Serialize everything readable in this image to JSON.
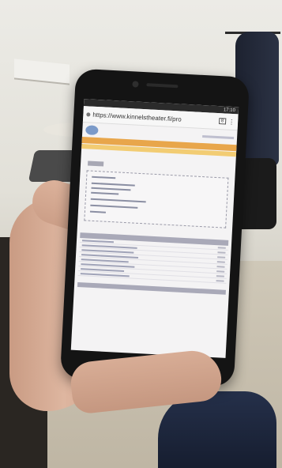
{
  "scene": {
    "description_tag": "",
    "phone": {
      "status_time": "17:10",
      "url": "https://www.kinnelstheater.fi/pro",
      "tab_count": "8",
      "menu_icon": "kebab-menu-icon"
    }
  },
  "colors": {
    "nav_orange": "#e8a64b",
    "subnav_yellow": "#f2cc73",
    "screen_bg": "#f4f3f4",
    "phone_body": "#141414"
  }
}
